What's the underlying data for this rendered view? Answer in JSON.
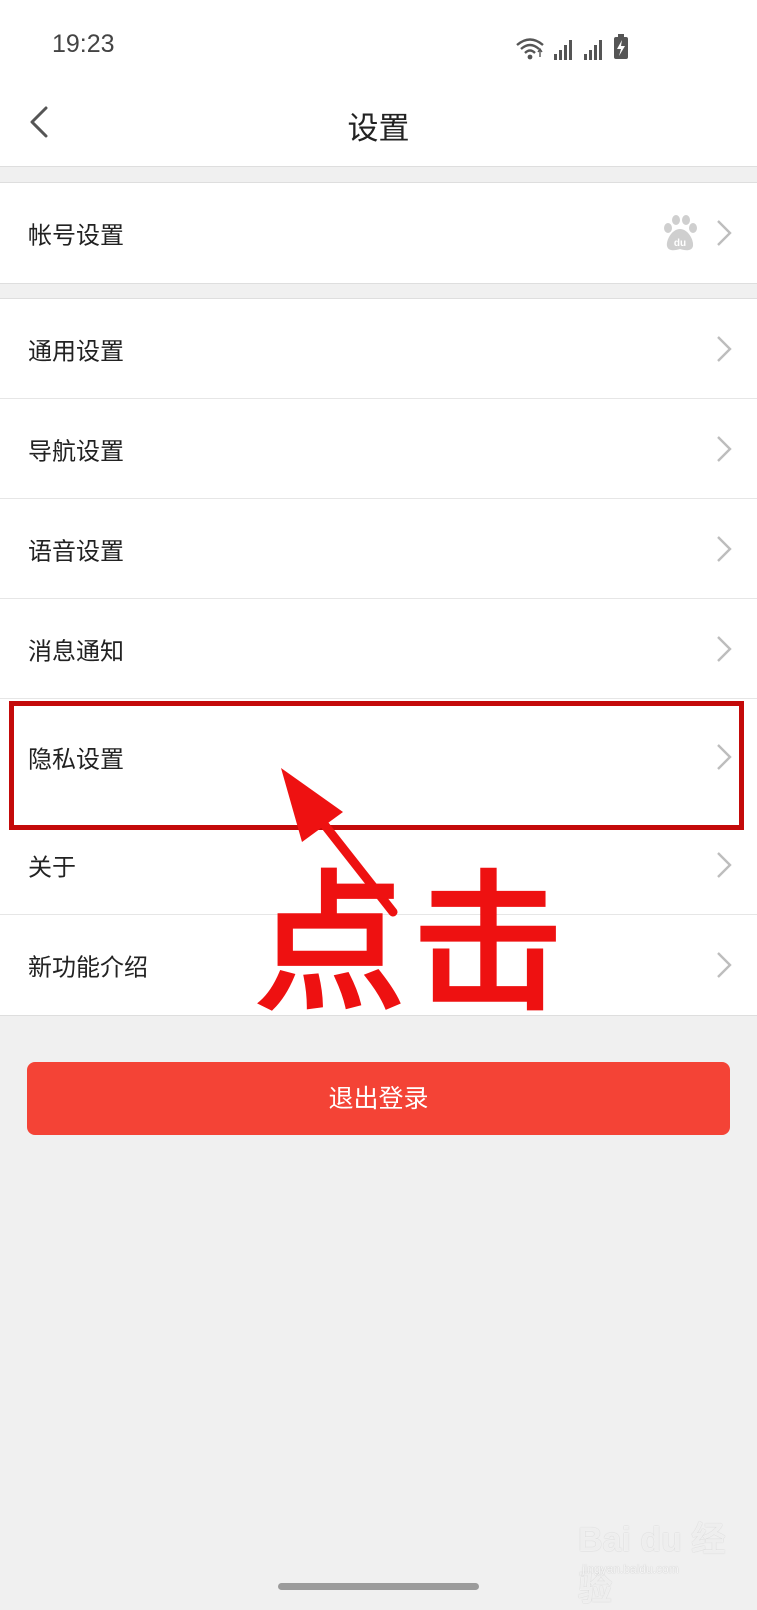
{
  "status_bar": {
    "time": "19:23"
  },
  "header": {
    "title": "设置"
  },
  "account_group": {
    "items": [
      {
        "label": "帐号设置"
      }
    ]
  },
  "settings_group": {
    "items": [
      {
        "label": "通用设置"
      },
      {
        "label": "导航设置"
      },
      {
        "label": "语音设置"
      },
      {
        "label": "消息通知"
      },
      {
        "label": "隐私设置"
      },
      {
        "label": "关于"
      },
      {
        "label": "新功能介绍"
      }
    ]
  },
  "logout_button": {
    "label": "退出登录"
  },
  "annotation": {
    "text": "点击",
    "color": "#ee1111"
  },
  "watermark": {
    "text": "Bai du 经验",
    "sub": "jingyan.baidu.com"
  },
  "colors": {
    "accent": "#f44336",
    "annotation": "#c40a0a",
    "background": "#f0f0f0"
  },
  "icons": {
    "back": "chevron-left-icon",
    "next": "chevron-right-icon",
    "account": "baidu-paw-icon"
  }
}
